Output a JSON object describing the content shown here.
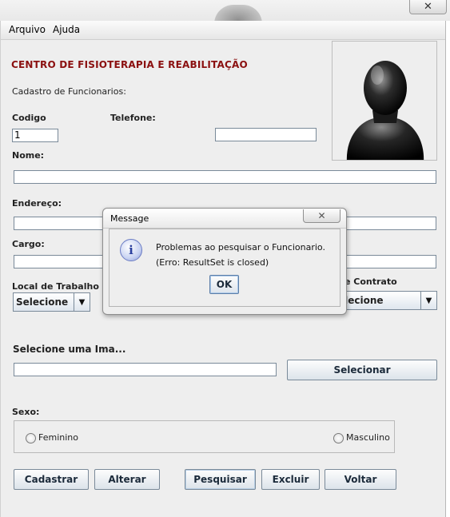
{
  "window": {
    "close_glyph": "✕"
  },
  "menubar": {
    "items": [
      {
        "label": "Arquivo"
      },
      {
        "label": "Ajuda"
      }
    ]
  },
  "form": {
    "title": "CENTRO DE FISIOTERAPIA E REABILITAÇÃO",
    "subtitle": "Cadastro de Funcionarios:",
    "codigo_label": "Codigo",
    "codigo_value": "1",
    "telefone_label": "Telefone:",
    "telefone_value": "",
    "nome_label": "Nome:",
    "nome_value": "",
    "endereco_label": "Endereço:",
    "endereco_value": "",
    "cargo_label": "Cargo:",
    "cargo_value": "",
    "local_label": "Local de Trabalho",
    "local_selected": "Selecione",
    "contrato_label_partial": "e Contrato",
    "contrato_selected_partial": "elecione",
    "imagem_label": "Selecione uma Ima...",
    "imagem_value": "",
    "selecionar_button": "Selecionar",
    "sexo_label": "Sexo:",
    "sexo_options": [
      {
        "label": "Feminino"
      },
      {
        "label": "Masculino"
      }
    ]
  },
  "actions": {
    "cadastrar": "Cadastrar",
    "alterar": "Alterar",
    "pesquisar": "Pesquisar",
    "excluir": "Excluir",
    "voltar": "Voltar"
  },
  "dialog": {
    "title": "Message",
    "close_glyph": "✕",
    "icon_glyph": "i",
    "line1": "Problemas ao pesquisar o Funcionario.",
    "line2": "(Erro: ResultSet is closed)",
    "ok_label": "OK"
  },
  "icons": {
    "combo_arrow": "▼",
    "photo": "user-silhouette-icon"
  },
  "colors": {
    "title": "#8b1010",
    "panel": "#eeeeee",
    "field_border": "#7a8a99"
  }
}
